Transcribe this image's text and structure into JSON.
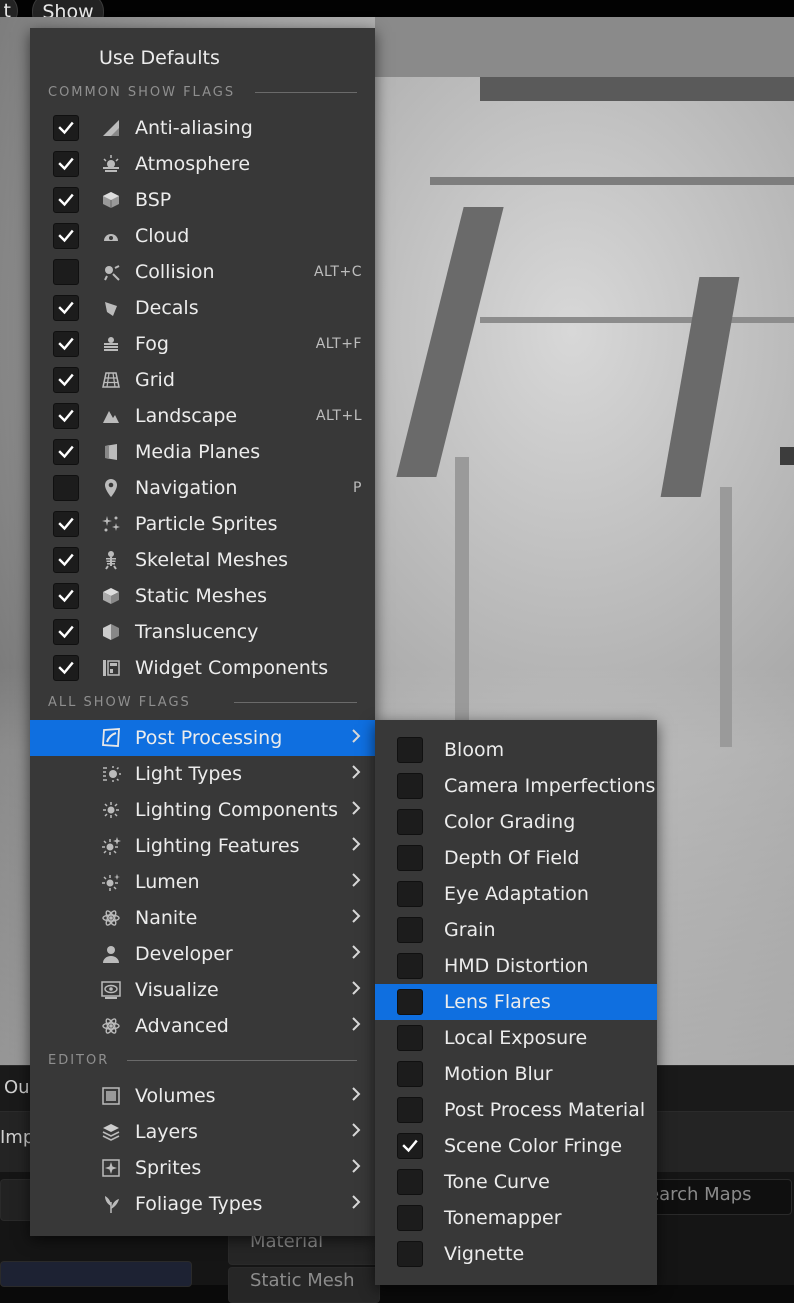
{
  "toolbar": {
    "left_button_label": "t",
    "show_button_label": "Show"
  },
  "lower_panel": {
    "tab_out": "Out",
    "tab_imp": "Imp",
    "search_maps_placeholder": "earch Maps",
    "item_material": "Material",
    "item_static_mesh": "Static Mesh"
  },
  "menu": {
    "use_defaults": "Use Defaults",
    "common_header": "COMMON SHOW FLAGS",
    "all_header": "ALL SHOW FLAGS",
    "editor_header": "EDITOR",
    "common_flags": [
      {
        "label": "Anti-aliasing",
        "checked": true,
        "shortcut": "",
        "icon": "anti-aliasing-icon"
      },
      {
        "label": "Atmosphere",
        "checked": true,
        "shortcut": "",
        "icon": "atmosphere-icon"
      },
      {
        "label": "BSP",
        "checked": true,
        "shortcut": "",
        "icon": "bsp-icon"
      },
      {
        "label": "Cloud",
        "checked": true,
        "shortcut": "",
        "icon": "cloud-icon"
      },
      {
        "label": "Collision",
        "checked": false,
        "shortcut": "ALT+C",
        "icon": "collision-icon"
      },
      {
        "label": "Decals",
        "checked": true,
        "shortcut": "",
        "icon": "decals-icon"
      },
      {
        "label": "Fog",
        "checked": true,
        "shortcut": "ALT+F",
        "icon": "fog-icon"
      },
      {
        "label": "Grid",
        "checked": true,
        "shortcut": "",
        "icon": "grid-icon"
      },
      {
        "label": "Landscape",
        "checked": true,
        "shortcut": "ALT+L",
        "icon": "landscape-icon"
      },
      {
        "label": "Media Planes",
        "checked": true,
        "shortcut": "",
        "icon": "media-planes-icon"
      },
      {
        "label": "Navigation",
        "checked": false,
        "shortcut": "P",
        "icon": "navigation-icon"
      },
      {
        "label": "Particle Sprites",
        "checked": true,
        "shortcut": "",
        "icon": "particle-sprites-icon"
      },
      {
        "label": "Skeletal Meshes",
        "checked": true,
        "shortcut": "",
        "icon": "skeletal-meshes-icon"
      },
      {
        "label": "Static Meshes",
        "checked": true,
        "shortcut": "",
        "icon": "static-meshes-icon"
      },
      {
        "label": "Translucency",
        "checked": true,
        "shortcut": "",
        "icon": "translucency-icon"
      },
      {
        "label": "Widget Components",
        "checked": true,
        "shortcut": "",
        "icon": "widget-components-icon"
      }
    ],
    "all_flags": [
      {
        "label": "Post Processing",
        "selected": true,
        "icon": "post-processing-icon"
      },
      {
        "label": "Light Types",
        "selected": false,
        "icon": "light-types-icon"
      },
      {
        "label": "Lighting Components",
        "selected": false,
        "icon": "lighting-components-icon"
      },
      {
        "label": "Lighting Features",
        "selected": false,
        "icon": "lighting-features-icon"
      },
      {
        "label": "Lumen",
        "selected": false,
        "icon": "lumen-icon"
      },
      {
        "label": "Nanite",
        "selected": false,
        "icon": "nanite-icon"
      },
      {
        "label": "Developer",
        "selected": false,
        "icon": "developer-icon"
      },
      {
        "label": "Visualize",
        "selected": false,
        "icon": "visualize-icon"
      },
      {
        "label": "Advanced",
        "selected": false,
        "icon": "advanced-icon"
      }
    ],
    "editor_flags": [
      {
        "label": "Volumes",
        "icon": "volumes-icon"
      },
      {
        "label": "Layers",
        "icon": "layers-icon"
      },
      {
        "label": "Sprites",
        "icon": "sprites-icon"
      },
      {
        "label": "Foliage Types",
        "icon": "foliage-types-icon"
      }
    ]
  },
  "submenu": {
    "items": [
      {
        "label": "Bloom",
        "checked": false,
        "selected": false
      },
      {
        "label": "Camera Imperfections",
        "checked": false,
        "selected": false
      },
      {
        "label": "Color Grading",
        "checked": false,
        "selected": false
      },
      {
        "label": "Depth Of Field",
        "checked": false,
        "selected": false
      },
      {
        "label": "Eye Adaptation",
        "checked": false,
        "selected": false
      },
      {
        "label": "Grain",
        "checked": false,
        "selected": false
      },
      {
        "label": "HMD Distortion",
        "checked": false,
        "selected": false
      },
      {
        "label": "Lens Flares",
        "checked": false,
        "selected": true
      },
      {
        "label": "Local Exposure",
        "checked": false,
        "selected": false
      },
      {
        "label": "Motion Blur",
        "checked": false,
        "selected": false
      },
      {
        "label": "Post Process Material",
        "checked": false,
        "selected": false
      },
      {
        "label": "Scene Color Fringe",
        "checked": true,
        "selected": false
      },
      {
        "label": "Tone Curve",
        "checked": false,
        "selected": false
      },
      {
        "label": "Tonemapper",
        "checked": false,
        "selected": false
      },
      {
        "label": "Vignette",
        "checked": false,
        "selected": false
      }
    ]
  },
  "colors": {
    "selection": "#0f6fe0",
    "menu_bg": "#383838",
    "checkbox_bg": "#1c1c1c"
  }
}
